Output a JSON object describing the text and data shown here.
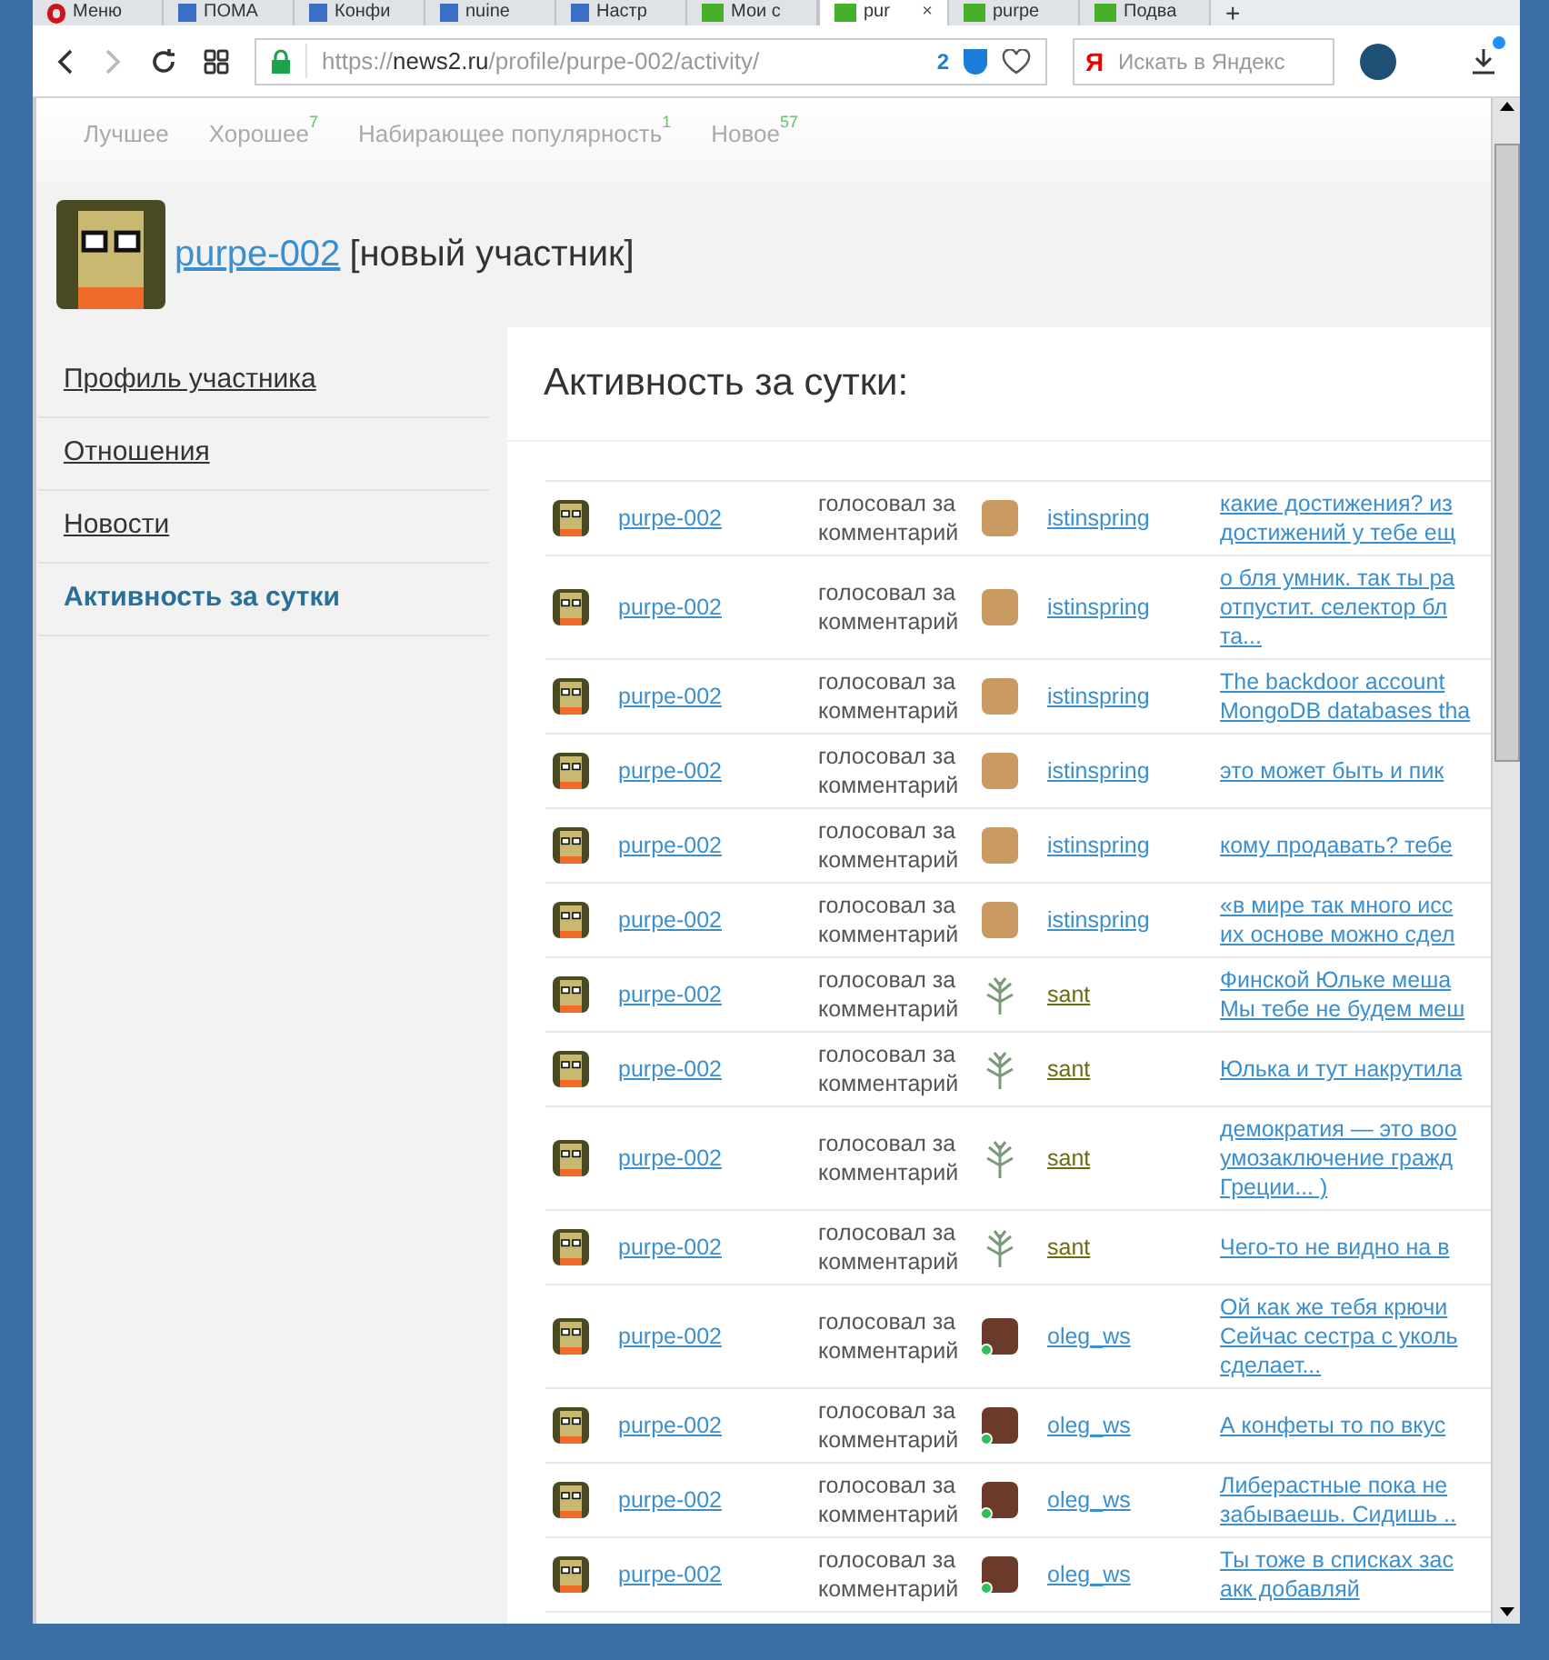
{
  "browser": {
    "tabs": [
      {
        "label": "Меню",
        "kind": "opera",
        "selected": false
      },
      {
        "label": "ПОМА",
        "kind": "blue",
        "selected": false
      },
      {
        "label": "Конфи",
        "kind": "blue",
        "selected": false
      },
      {
        "label": "nuine",
        "kind": "blue",
        "selected": false
      },
      {
        "label": "Настр",
        "kind": "blue",
        "selected": false
      },
      {
        "label": "Мои с",
        "kind": "green",
        "selected": false
      },
      {
        "label": "pur",
        "kind": "green",
        "selected": true,
        "close": "×"
      },
      {
        "label": "purpe",
        "kind": "green",
        "selected": false
      },
      {
        "label": "Подва",
        "kind": "green",
        "selected": false
      }
    ],
    "new_tab": "+",
    "address": {
      "scheme": "https://",
      "host": "news2.ru",
      "path": "/profile/purpe-002/activity/"
    },
    "blocked_count": "2",
    "search": {
      "logo": "Я",
      "placeholder": "Искать в Яндекс"
    }
  },
  "top_nav": [
    {
      "label": "Лучшее"
    },
    {
      "label": "Хорошее",
      "count": "7"
    },
    {
      "label": "Набирающее популярность",
      "count": "1"
    },
    {
      "label": "Новое",
      "count": "57"
    }
  ],
  "profile": {
    "username": "purpe-002",
    "status": "[новый участник]"
  },
  "sidebar": {
    "items": [
      {
        "label": "Профиль участника",
        "selected": false
      },
      {
        "label": "Отношения",
        "selected": false
      },
      {
        "label": "Новости",
        "selected": false
      },
      {
        "label": "Активность за сутки",
        "selected": true
      }
    ]
  },
  "content": {
    "title": "Активность за сутки:",
    "rows": [
      {
        "user": "purpe-002",
        "action": "голосовал за комментарий",
        "voter": {
          "name": "istinspring",
          "kind": "photo",
          "color": "#3a8fd0",
          "online": false
        },
        "comment": [
          "какие достижения? из",
          "достижений у тебе ещ"
        ]
      },
      {
        "user": "purpe-002",
        "action": "голосовал за комментарий",
        "voter": {
          "name": "istinspring",
          "kind": "photo",
          "color": "#3a8fd0",
          "online": false
        },
        "comment": [
          "о бля умник. так ты ра",
          "отпустит. селектор бл",
          "та..."
        ]
      },
      {
        "user": "purpe-002",
        "action": "голосовал за комментарий",
        "voter": {
          "name": "istinspring",
          "kind": "photo",
          "color": "#3a8fd0",
          "online": false
        },
        "comment": [
          "The backdoor account",
          "MongoDB databases tha"
        ]
      },
      {
        "user": "purpe-002",
        "action": "голосовал за комментарий",
        "voter": {
          "name": "istinspring",
          "kind": "photo",
          "color": "#3a8fd0",
          "online": false
        },
        "comment": [
          "это может быть и пик"
        ]
      },
      {
        "user": "purpe-002",
        "action": "голосовал за комментарий",
        "voter": {
          "name": "istinspring",
          "kind": "photo",
          "color": "#3a8fd0",
          "online": false
        },
        "comment": [
          "кому продавать? тебе"
        ]
      },
      {
        "user": "purpe-002",
        "action": "голосовал за комментарий",
        "voter": {
          "name": "istinspring",
          "kind": "photo",
          "color": "#3a8fd0",
          "online": false
        },
        "comment": [
          "«в мире так много исс",
          "их основе можно сдел"
        ]
      },
      {
        "user": "purpe-002",
        "action": "голосовал за комментарий",
        "voter": {
          "name": "sant",
          "kind": "tree",
          "color": "#6b6b10",
          "online": false
        },
        "comment": [
          "Финской Юльке меша",
          "Мы тебе не будем меш"
        ]
      },
      {
        "user": "purpe-002",
        "action": "голосовал за комментарий",
        "voter": {
          "name": "sant",
          "kind": "tree",
          "color": "#6b6b10",
          "online": false
        },
        "comment": [
          "Юлька и тут накрутила"
        ]
      },
      {
        "user": "purpe-002",
        "action": "голосовал за комментарий",
        "voter": {
          "name": "sant",
          "kind": "tree",
          "color": "#6b6b10",
          "online": false
        },
        "comment": [
          "демократия — это воо",
          "умозаключение гражд",
          "Греции... )"
        ]
      },
      {
        "user": "purpe-002",
        "action": "голосовал за комментарий",
        "voter": {
          "name": "sant",
          "kind": "tree",
          "color": "#6b6b10",
          "online": false
        },
        "comment": [
          "Чего-то не видно на в"
        ]
      },
      {
        "user": "purpe-002",
        "action": "голосовал за комментарий",
        "voter": {
          "name": "oleg_ws",
          "kind": "pixel",
          "color": "#3a8fd0",
          "online": true
        },
        "comment": [
          "Ой как же тебя крючи",
          "Сейчас сестра с уколь",
          "сделает..."
        ]
      },
      {
        "user": "purpe-002",
        "action": "голосовал за комментарий",
        "voter": {
          "name": "oleg_ws",
          "kind": "pixel",
          "color": "#3a8fd0",
          "online": true
        },
        "comment": [
          "А конфеты то по вкус"
        ]
      },
      {
        "user": "purpe-002",
        "action": "голосовал за комментарий",
        "voter": {
          "name": "oleg_ws",
          "kind": "pixel",
          "color": "#3a8fd0",
          "online": true
        },
        "comment": [
          "Либерастные пока не",
          "забываешь. Сидишь .."
        ]
      },
      {
        "user": "purpe-002",
        "action": "голосовал за комментарий",
        "voter": {
          "name": "oleg_ws",
          "kind": "pixel",
          "color": "#3a8fd0",
          "online": true
        },
        "comment": [
          "Ты тоже в списках зас",
          "акк добавляй"
        ]
      }
    ]
  }
}
